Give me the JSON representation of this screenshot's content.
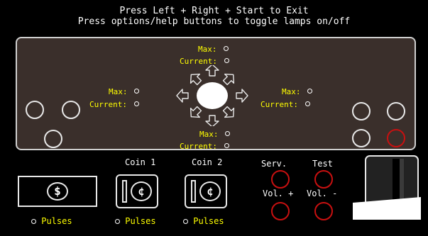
{
  "header": {
    "line1": "Press  Left + Right + Start  to Exit",
    "line2": "Press options/help buttons to toggle lamps on/off"
  },
  "joystick": {
    "up": {
      "max_label": "Max:",
      "current_label": "Current:"
    },
    "left": {
      "max_label": "Max:",
      "current_label": "Current:"
    },
    "right": {
      "max_label": "Max:",
      "current_label": "Current:"
    },
    "down": {
      "max_label": "Max:",
      "current_label": "Current:"
    }
  },
  "coins": {
    "coin1_label": "Coin 1",
    "coin2_label": "Coin 2",
    "dollar_symbol": "$",
    "cent_symbol": "¢"
  },
  "pulses": {
    "label": "Pulses"
  },
  "service": {
    "serv_label": "Serv.",
    "test_label": "Test",
    "volplus_label": "Vol. +",
    "volminus_label": "Vol. -"
  },
  "colors": {
    "accent_yellow": "#ffff00",
    "lamp_red": "#c81010",
    "panel_bg": "#3a2f2b"
  }
}
